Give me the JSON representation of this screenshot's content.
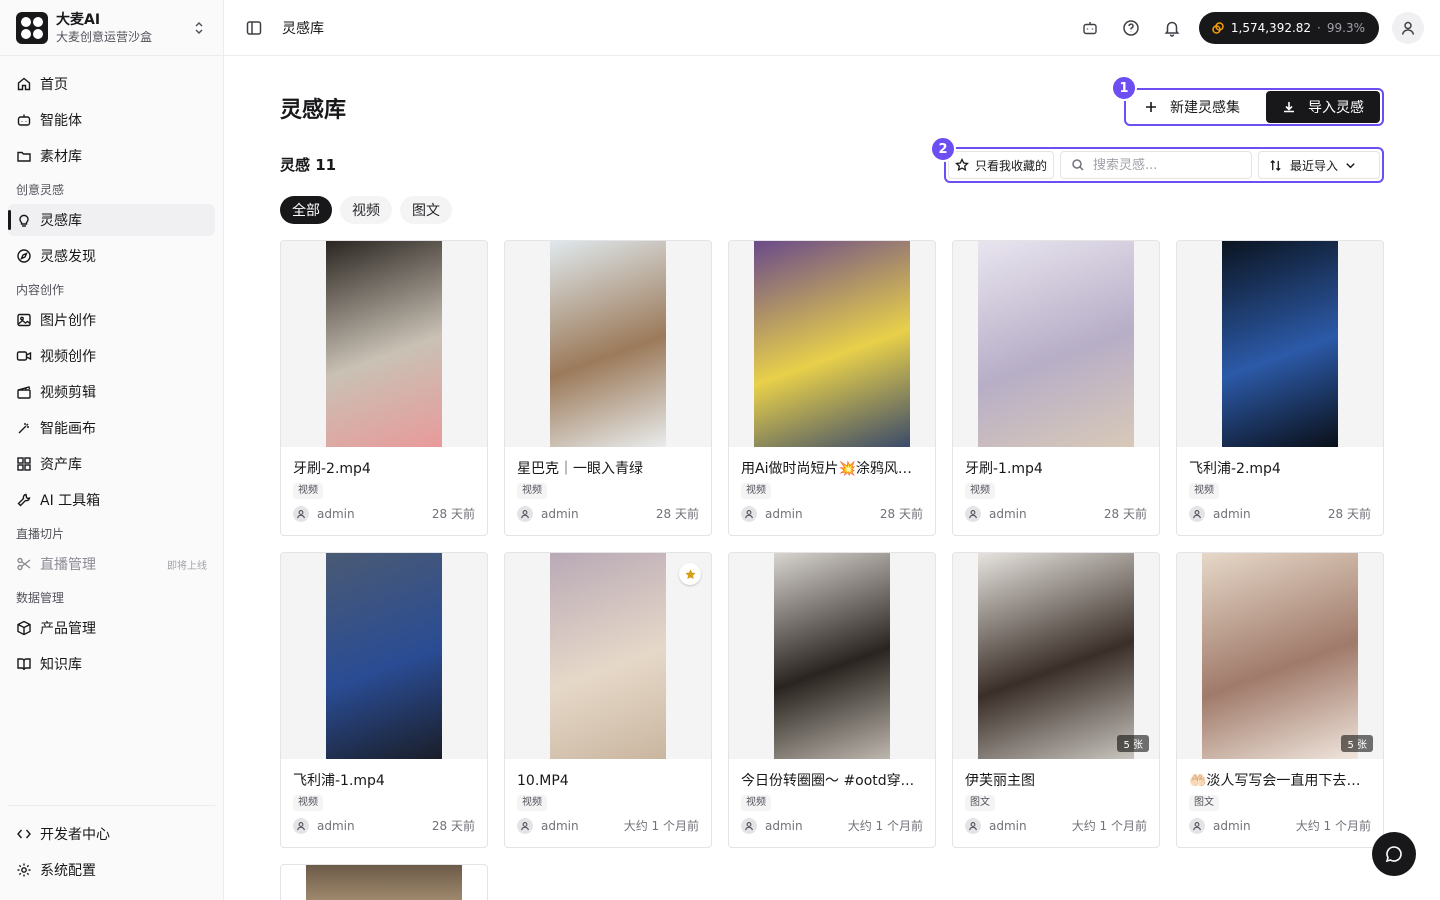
{
  "brand": {
    "name": "大麦AI",
    "subtitle": "大麦创意运营沙盒"
  },
  "sidebar": {
    "top_items": [
      {
        "label": "首页",
        "icon": "home-icon"
      },
      {
        "label": "智能体",
        "icon": "robot-icon"
      },
      {
        "label": "素材库",
        "icon": "folder-icon"
      }
    ],
    "groups": [
      {
        "label": "创意灵感",
        "items": [
          {
            "label": "灵感库",
            "icon": "lightbulb-icon",
            "active": true
          },
          {
            "label": "灵感发现",
            "icon": "compass-icon"
          }
        ]
      },
      {
        "label": "内容创作",
        "items": [
          {
            "label": "图片创作",
            "icon": "image-icon"
          },
          {
            "label": "视频创作",
            "icon": "video-icon"
          },
          {
            "label": "视频剪辑",
            "icon": "clapper-icon"
          },
          {
            "label": "智能画布",
            "icon": "magic-wand-icon"
          },
          {
            "label": "资产库",
            "icon": "grid-icon"
          },
          {
            "label": "AI 工具箱",
            "icon": "wrench-icon"
          }
        ]
      },
      {
        "label": "直播切片",
        "items": [
          {
            "label": "直播管理",
            "icon": "scissors-icon",
            "disabled": true,
            "badge": "即将上线"
          }
        ]
      },
      {
        "label": "数据管理",
        "items": [
          {
            "label": "产品管理",
            "icon": "box-icon"
          },
          {
            "label": "知识库",
            "icon": "book-icon"
          }
        ]
      }
    ],
    "bottom_items": [
      {
        "label": "开发者中心",
        "icon": "code-icon"
      },
      {
        "label": "系统配置",
        "icon": "settings-icon"
      }
    ]
  },
  "topbar": {
    "breadcrumb": "灵感库",
    "credits": "1,574,392.82",
    "credits_separator": "·",
    "credits_pct": "99.3%"
  },
  "page": {
    "title": "灵感库",
    "new_collection": "新建灵感集",
    "import": "导入灵感",
    "count_label": "灵感 11",
    "fav_filter": "只看我收藏的",
    "search_placeholder": "搜索灵感...",
    "sort_label": "最近导入",
    "callouts": [
      "1",
      "2"
    ],
    "tabs": [
      "全部",
      "视频",
      "图文"
    ]
  },
  "cards": [
    {
      "title": "牙刷-2.mp4",
      "type": "视频",
      "user": "admin",
      "time": "28 天前",
      "colors": [
        "#2b2622",
        "#c9c1b4",
        "#e89a9a"
      ],
      "wide": false
    },
    {
      "title": "星巴克｜一眼入青绿",
      "type": "视频",
      "user": "admin",
      "time": "28 天前",
      "colors": [
        "#dfe8ec",
        "#9c7a5a",
        "#e9ecec"
      ],
      "wide": false
    },
    {
      "title": "用Ai做时尚短片💥涂鸦风✍️...",
      "type": "视频",
      "user": "admin",
      "time": "28 天前",
      "colors": [
        "#6a4a8a",
        "#e8d04a",
        "#3a4a6a"
      ],
      "wide": true
    },
    {
      "title": "牙刷-1.mp4",
      "type": "视频",
      "user": "admin",
      "time": "28 天前",
      "colors": [
        "#e9e5ef",
        "#b7aec7",
        "#d8c9b8"
      ],
      "wide": true
    },
    {
      "title": "飞利浦-2.mp4",
      "type": "视频",
      "user": "admin",
      "time": "28 天前",
      "colors": [
        "#0b1420",
        "#2c5aa8",
        "#0a0f18"
      ],
      "wide": false
    },
    {
      "title": "飞利浦-1.mp4",
      "type": "视频",
      "user": "admin",
      "time": "28 天前",
      "colors": [
        "#4a5a74",
        "#2a4c94",
        "#1a1e28"
      ],
      "wide": false
    },
    {
      "title": "10.MP4",
      "type": "视频",
      "user": "admin",
      "time": "大约 1 个月前",
      "colors": [
        "#b9a9b6",
        "#e6d8c8",
        "#c9b6a0"
      ],
      "wide": false,
      "starred": true
    },
    {
      "title": "今日份转圈圈～ #ootd穿...",
      "type": "视频",
      "user": "admin",
      "time": "大约 1 个月前",
      "colors": [
        "#d8d4cf",
        "#2a2420",
        "#bdb7ae"
      ],
      "wide": false
    },
    {
      "title": "伊芙丽主图",
      "type": "图文",
      "user": "admin",
      "time": "大约 1 个月前",
      "colors": [
        "#e6e3de",
        "#3a2e28",
        "#c9c5bf"
      ],
      "wide": true,
      "count_tag": "5 张"
    },
    {
      "title": "🤲🏻淡人写写会一直用下去的...",
      "type": "图文",
      "user": "admin",
      "time": "大约 1 个月前",
      "colors": [
        "#e6d8c9",
        "#a07a6a",
        "#f0e6dd"
      ],
      "wide": true,
      "count_tag": "5 张"
    }
  ]
}
